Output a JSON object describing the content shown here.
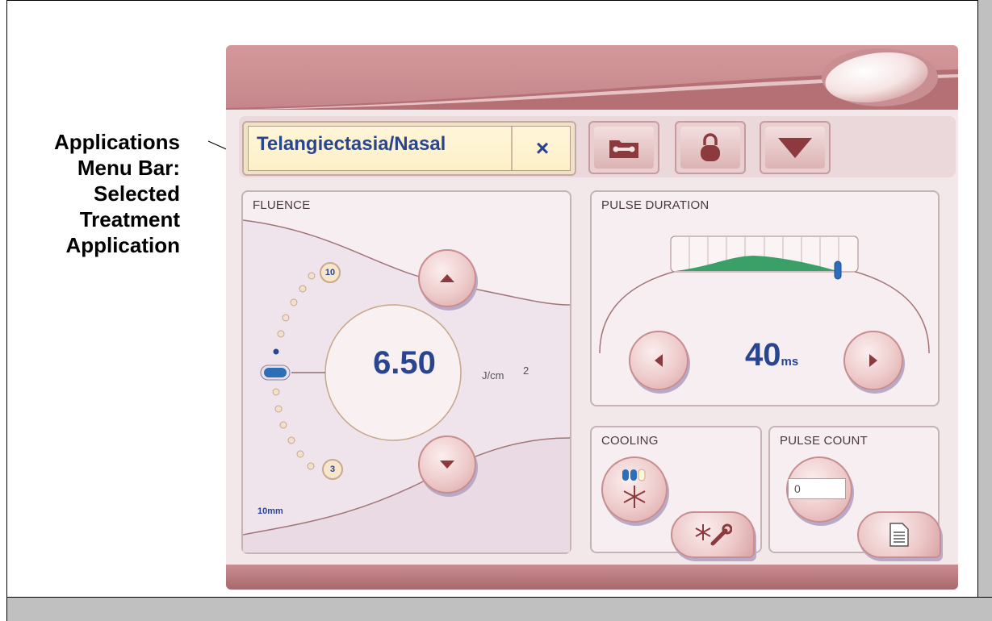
{
  "caption": {
    "lines": [
      "Applications",
      "Menu Bar:",
      "Selected",
      "Treatment",
      "Application"
    ]
  },
  "menubar": {
    "application_name": "Telangiectasia/Nasal",
    "clear_label": "×",
    "buttons": [
      {
        "name": "tools-folder",
        "icon": "folder-wrench-icon"
      },
      {
        "name": "lock",
        "icon": "padlock-icon"
      },
      {
        "name": "dropdown",
        "icon": "triangle-down-icon"
      }
    ]
  },
  "fluence": {
    "title": "FLUENCE",
    "value": "6.50",
    "unit": "J/cm",
    "unit_superscript": "2",
    "scale_max": "10",
    "scale_min": "3",
    "spot_size": "10mm"
  },
  "pulse_duration": {
    "title": "PULSE DURATION",
    "value": "40",
    "unit": "ms"
  },
  "cooling": {
    "title": "COOLING"
  },
  "pulse_count": {
    "title": "PULSE COUNT",
    "value": "0"
  },
  "colors": {
    "accent_text": "#2a4590",
    "chrome": "#c98e92",
    "panel": "#f6eef0",
    "bar_green": "#3aa068"
  }
}
